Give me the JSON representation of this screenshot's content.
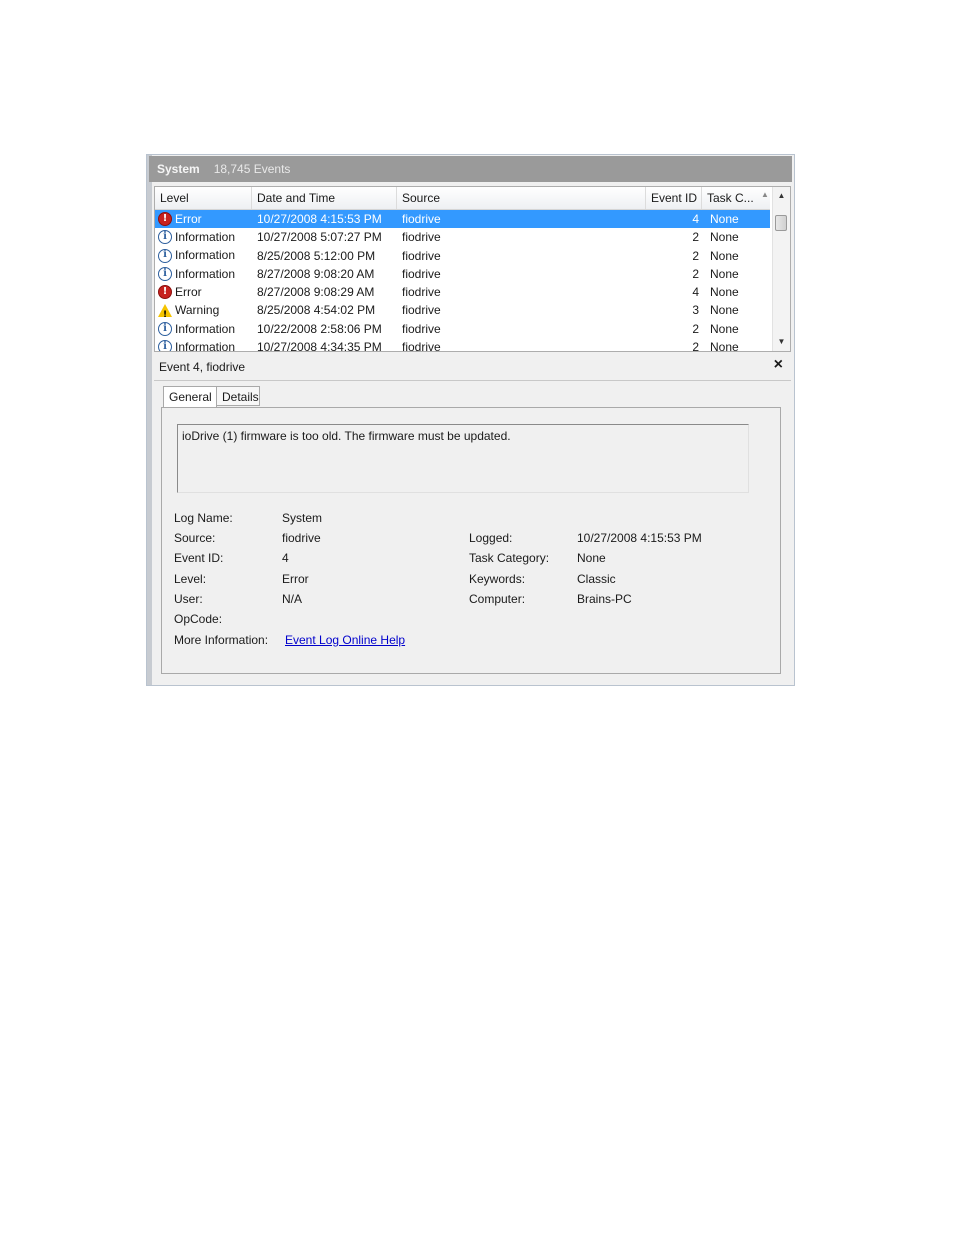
{
  "header": {
    "log_name": "System",
    "event_count": "18,745 Events"
  },
  "columns": {
    "level": "Level",
    "date": "Date and Time",
    "source": "Source",
    "event_id": "Event ID",
    "task": "Task C..."
  },
  "events": [
    {
      "level": "Error",
      "icon": "error-icon",
      "date": "10/27/2008 4:15:53 PM",
      "source": "fiodrive",
      "event_id": "4",
      "task": "None",
      "selected": true
    },
    {
      "level": "Information",
      "icon": "info-icon",
      "date": "10/27/2008 5:07:27 PM",
      "source": "fiodrive",
      "event_id": "2",
      "task": "None"
    },
    {
      "level": "Information",
      "icon": "info-icon",
      "date": "8/25/2008 5:12:00 PM",
      "source": "fiodrive",
      "event_id": "2",
      "task": "None"
    },
    {
      "level": "Information",
      "icon": "info-icon",
      "date": "8/27/2008 9:08:20 AM",
      "source": "fiodrive",
      "event_id": "2",
      "task": "None"
    },
    {
      "level": "Error",
      "icon": "error-icon",
      "date": "8/27/2008 9:08:29 AM",
      "source": "fiodrive",
      "event_id": "4",
      "task": "None"
    },
    {
      "level": "Warning",
      "icon": "warning-icon",
      "date": "8/25/2008 4:54:02 PM",
      "source": "fiodrive",
      "event_id": "3",
      "task": "None"
    },
    {
      "level": "Information",
      "icon": "info-icon",
      "date": "10/22/2008 2:58:06 PM",
      "source": "fiodrive",
      "event_id": "2",
      "task": "None"
    },
    {
      "level": "Information",
      "icon": "info-icon",
      "date": "10/27/2008 4:34:35 PM",
      "source": "fiodrive",
      "event_id": "2",
      "task": "None"
    }
  ],
  "detail": {
    "title": "Event 4, fiodrive",
    "close_glyph": "×",
    "tabs": {
      "general": "General",
      "details": "Details"
    },
    "message": "ioDrive (1) firmware is too old. The firmware must be updated.",
    "labels": {
      "log_name": "Log Name:",
      "source": "Source:",
      "event_id": "Event ID:",
      "level": "Level:",
      "user": "User:",
      "opcode": "OpCode:",
      "more_info": "More Information:",
      "logged": "Logged:",
      "task_category": "Task Category:",
      "keywords": "Keywords:",
      "computer": "Computer:"
    },
    "values": {
      "log_name": "System",
      "source": "fiodrive",
      "event_id": "4",
      "level": "Error",
      "user": "N/A",
      "logged": "10/27/2008 4:15:53 PM",
      "task_category": "None",
      "keywords": "Classic",
      "computer": "Brains-PC"
    },
    "help_link": "Event Log Online Help"
  },
  "colors": {
    "selection": "#3399ff",
    "header_bar": "#9a9a9a",
    "error": "#c7221f",
    "warning": "#f5c400",
    "info": "#2d5f9e",
    "link": "#0000cc"
  }
}
